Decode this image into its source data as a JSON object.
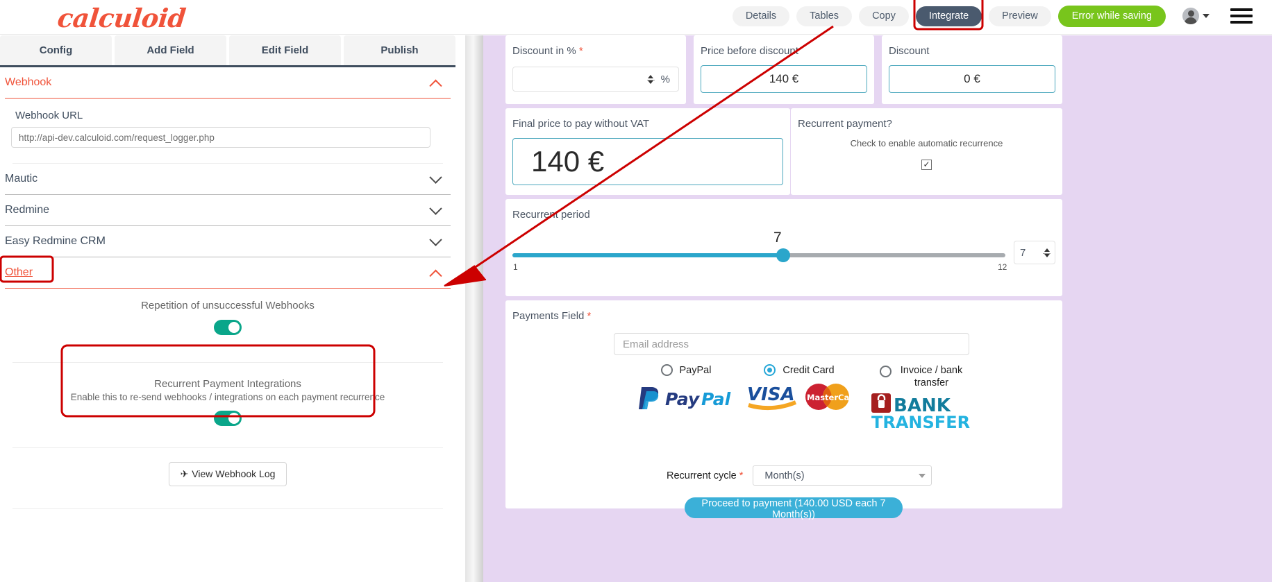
{
  "brand": {
    "logo_text": "calculoid",
    "logo_color": "#f0533a"
  },
  "topbar": {
    "nav": [
      {
        "label": "Details",
        "active": false
      },
      {
        "label": "Tables",
        "active": false
      },
      {
        "label": "Copy",
        "active": false
      },
      {
        "label": "Integrate",
        "active": true
      },
      {
        "label": "Preview",
        "active": false
      }
    ],
    "status_button": {
      "label": "Error while saving",
      "color": "#78c51c"
    },
    "account_icon": "user-avatar-icon",
    "menu_icon": "hamburger-menu-icon"
  },
  "tabs": [
    {
      "label": "Config"
    },
    {
      "label": "Add Field"
    },
    {
      "label": "Edit Field"
    },
    {
      "label": "Publish"
    }
  ],
  "sidebar": {
    "sections": [
      {
        "title": "Webhook",
        "expanded": true,
        "highlight": false
      },
      {
        "title": "Mautic",
        "expanded": false,
        "highlight": false
      },
      {
        "title": "Redmine",
        "expanded": false,
        "highlight": false
      },
      {
        "title": "Easy Redmine CRM",
        "expanded": false,
        "highlight": false
      },
      {
        "title": "Other",
        "expanded": true,
        "highlight": true
      }
    ],
    "webhook": {
      "url_label": "Webhook URL",
      "url_value": "http://api-dev.calculoid.com/request_logger.php"
    },
    "other": {
      "repetition": {
        "title": "Repetition of unsuccessful Webhooks",
        "toggle_state": "on"
      },
      "recurrent_integrations": {
        "title": "Recurrent Payment Integrations",
        "description": "Enable this to re-send webhooks / integrations on each payment recurrence",
        "toggle_state": "on"
      },
      "view_log_button": "View Webhook Log",
      "view_log_icon": "paper-plane-icon"
    }
  },
  "preview": {
    "discount_pct": {
      "label": "Discount in %",
      "required": true,
      "value": "",
      "unit": "%"
    },
    "price_before_discount": {
      "label": "Price before discount",
      "value": "140 €"
    },
    "discount": {
      "label": "Discount",
      "value": "0 €"
    },
    "final_price": {
      "label": "Final price to pay without VAT",
      "value": "140 €"
    },
    "recurrent_payment": {
      "label": "Recurrent payment?",
      "hint": "Check to enable automatic recurrence",
      "checked": true,
      "check_glyph": "✓"
    },
    "recurrent_period": {
      "label": "Recurrent period",
      "value": "7",
      "min": "1",
      "max": "12",
      "input_value": "7"
    },
    "payments": {
      "label": "Payments Field",
      "required": true,
      "email_placeholder": "Email address",
      "email_value": "",
      "methods": [
        {
          "label": "PayPal",
          "selected": false,
          "logo": "paypal-logo"
        },
        {
          "label": "Credit Card",
          "selected": true,
          "logo": "visa-mastercard-logo"
        },
        {
          "label": "Invoice / bank transfer",
          "selected": false,
          "logo": "bank-transfer-logo"
        }
      ],
      "cycle_label": "Recurrent cycle",
      "cycle_required": true,
      "cycle_value": "Month(s)",
      "proceed_button": "Proceed to payment (140.00 USD each 7 Month(s))"
    }
  },
  "annotations": {
    "color": "#cc0000",
    "items": [
      {
        "name": "integrate-button-highlight"
      },
      {
        "name": "other-section-highlight"
      },
      {
        "name": "recurrent-payment-integrations-highlight"
      },
      {
        "name": "arrow-from-integrate-to-other"
      }
    ]
  }
}
